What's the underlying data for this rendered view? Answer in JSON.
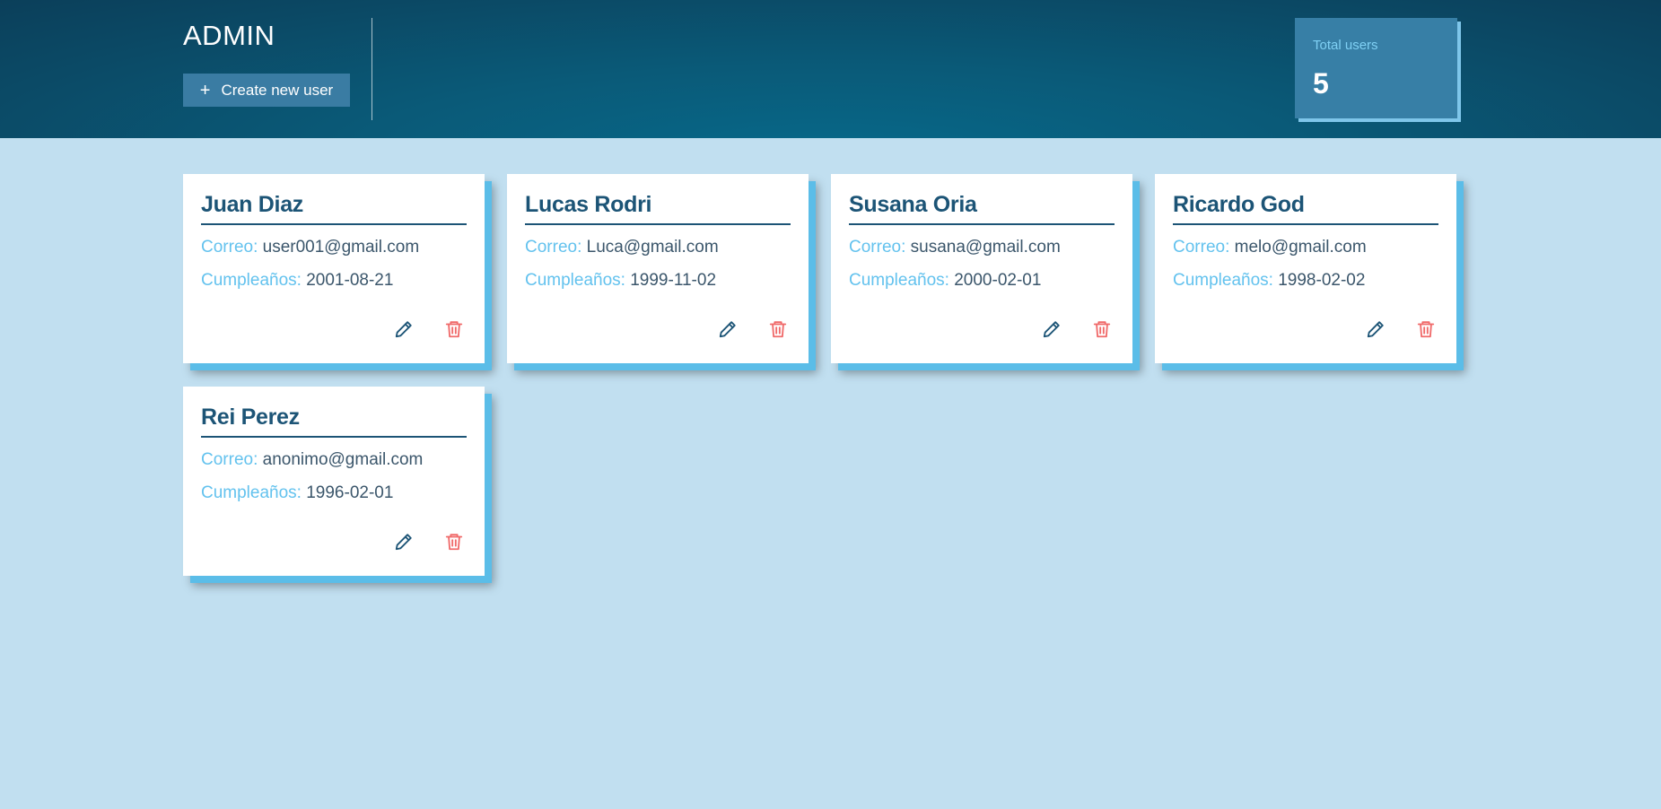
{
  "header": {
    "title": "ADMIN",
    "create_button_label": "Create new user",
    "create_button_icon": "plus-icon",
    "total_label": "Total users",
    "total_value": "5"
  },
  "card_labels": {
    "email": "Correo:",
    "birthday": "Cumpleaños:"
  },
  "icons": {
    "edit": "pencil-icon",
    "delete": "trash-icon"
  },
  "colors": {
    "header_bg": "#0b4a66",
    "page_bg": "#c1dff0",
    "accent_light": "#63c2ee",
    "name_color": "#1c5476",
    "delete_color": "#f06a6a",
    "edit_color": "#1c5476"
  },
  "users": [
    {
      "name": "Juan Diaz",
      "email": "user001@gmail.com",
      "birthday": "2001-08-21"
    },
    {
      "name": "Lucas Rodri",
      "email": "Luca@gmail.com",
      "birthday": "1999-11-02"
    },
    {
      "name": "Susana Oria",
      "email": "susana@gmail.com",
      "birthday": "2000-02-01"
    },
    {
      "name": "Ricardo God",
      "email": "melo@gmail.com",
      "birthday": "1998-02-02"
    },
    {
      "name": "Rei Perez",
      "email": "anonimo@gmail.com",
      "birthday": "1996-02-01"
    }
  ]
}
